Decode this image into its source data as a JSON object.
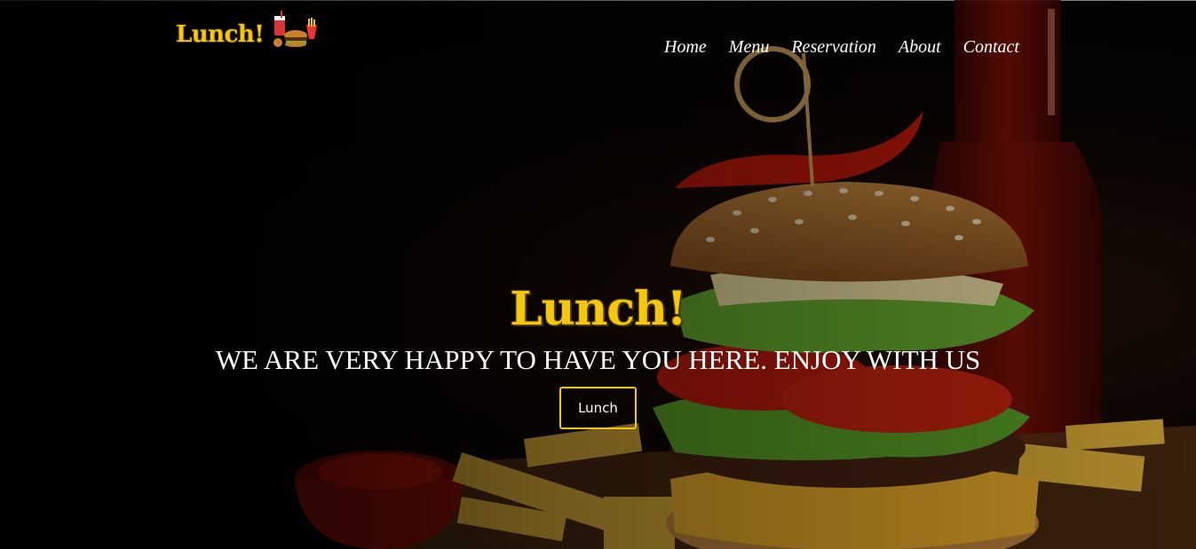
{
  "brand": {
    "name": "Lunch!",
    "icon": "fast-food-icon"
  },
  "nav": {
    "items": [
      {
        "label": "Home"
      },
      {
        "label": "Menu"
      },
      {
        "label": "Reservation"
      },
      {
        "label": "About"
      },
      {
        "label": "Contact"
      }
    ]
  },
  "hero": {
    "title": "Lunch!",
    "subtitle": "WE ARE VERY HAPPY TO HAVE YOU HERE. ENJOY WITH US",
    "button_label": "Lunch",
    "background": "burger-with-fries-and-ketchup-photo"
  },
  "colors": {
    "accent": "#f4c70c",
    "text": "#ffffff",
    "background": "#050505"
  }
}
